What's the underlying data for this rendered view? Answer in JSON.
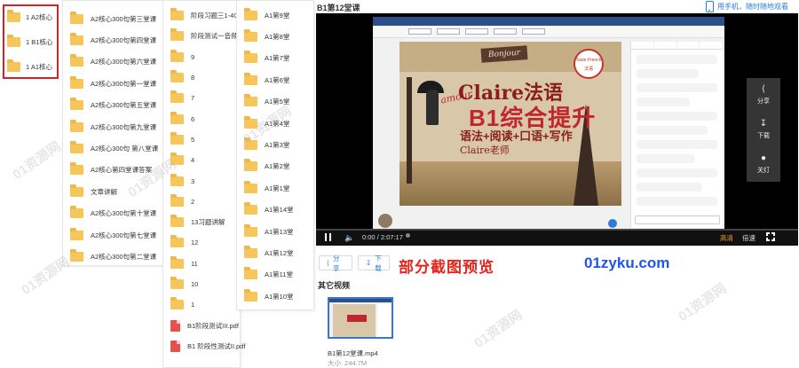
{
  "col0": {
    "items": [
      "1 A2核心",
      "1 B1核心",
      "1 A1核心"
    ]
  },
  "col1": {
    "items": [
      "A2核心300句第三堂课",
      "A2核心300句第四堂课",
      "A2核心300句第六堂课",
      "A2核心300句第一堂课",
      "A2核心300句第五堂课",
      "A2核心300句第九堂课",
      "A2核心300句 第八堂课",
      "A2核心第四堂课答案",
      "文章讲解",
      "A2核心300句第十堂课",
      "A2核心300句第七堂课",
      "A2核心300句第二堂课"
    ]
  },
  "col2": {
    "folders": [
      "阶段习题三1-40",
      "阶段测试一音频讲解",
      "9",
      "8",
      "7",
      "6",
      "5",
      "4",
      "3",
      "2",
      "13习题讲解",
      "12",
      "11",
      "10",
      "1"
    ],
    "files": [
      "B1阶段测试III.pdf",
      "B1 阶段性测试II.pdf"
    ]
  },
  "col3": {
    "items": [
      "A1第9堂",
      "A1第8堂",
      "A1第7堂",
      "A1第6堂",
      "A1第5堂",
      "A1第4堂",
      "A1第3堂",
      "A1第2堂",
      "A1第1堂",
      "A1第14堂",
      "A1第13堂",
      "A1第12堂",
      "A1第11堂",
      "A1第10堂"
    ]
  },
  "video": {
    "title": "B1第12堂课",
    "mobile_link": "用手机，随时随地观看",
    "slide": {
      "bonjour": "Bonjour",
      "badge": "Taste French 法语",
      "claire": "Claire法语",
      "amour": "amour",
      "b1": "B1综合提升",
      "subline": "语法+阅读+口语+写作",
      "teacher": "Claire老师"
    },
    "side": {
      "share": "分享",
      "download": "下载",
      "light_off": "关灯"
    },
    "time": "0:00 / 2:07:17",
    "quality": "高清",
    "speed": "倍速"
  },
  "actions": {
    "share": "分享",
    "download": "下载"
  },
  "promo": {
    "left": "部分截图预览",
    "right": "01zyku.com"
  },
  "other": {
    "heading": "其它视频",
    "video_name": "B1第12堂课.mp4",
    "video_size": "大小: 244.7M"
  },
  "watermark": "01资源网",
  "colors": {
    "accent": "#2a7dd8",
    "promo_red": "#e7241d",
    "promo_blue": "#1e56e6",
    "folder": "#f7c65a",
    "highlight_box": "#e02020"
  }
}
